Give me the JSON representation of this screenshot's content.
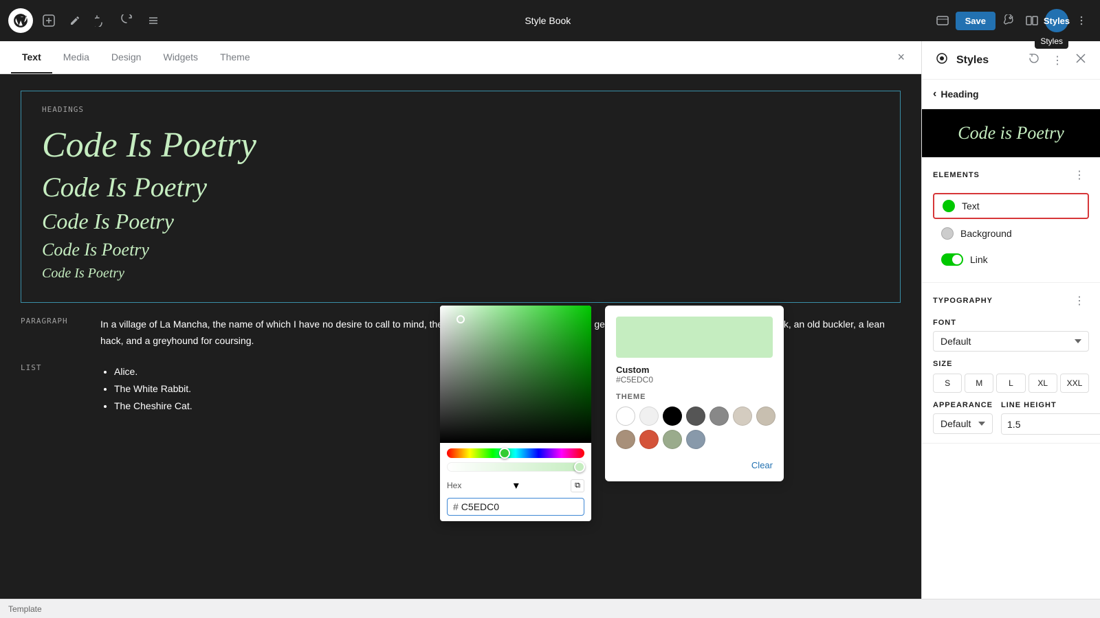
{
  "topbar": {
    "title": "Style Book",
    "save_label": "Save",
    "styles_label": "Styles",
    "styles_tooltip": "Styles"
  },
  "tabs": {
    "items": [
      {
        "label": "Text",
        "active": true
      },
      {
        "label": "Media",
        "active": false
      },
      {
        "label": "Design",
        "active": false
      },
      {
        "label": "Widgets",
        "active": false
      },
      {
        "label": "Theme",
        "active": false
      }
    ]
  },
  "canvas": {
    "headings_label": "HEADINGS",
    "heading_1": "Code Is Poetry",
    "heading_2": "Code Is Poetry",
    "heading_3": "Code Is Poetry",
    "heading_4": "Code Is Poetry",
    "heading_5": "Code Is Poetry",
    "paragraph_label": "PARAGRAPH",
    "paragraph_text": "In a village of La Mancha, the name of which I have no desire to call to mind, there lived not long since one of those gentlemen that keep a lance in the lance-rack, an old buckler, a lean hack, and a greyhound for coursing.",
    "list_label": "LIST",
    "list_item_1": "Alice.",
    "list_item_2": "The White Rabbit.",
    "list_item_3": "The Cheshire Cat."
  },
  "color_picker": {
    "format_label": "Hex",
    "hex_value": "C5EDC0",
    "hash_symbol": "#"
  },
  "theme_popup": {
    "custom_label": "Custom",
    "hex_label": "#C5EDC0",
    "section_label": "THEME",
    "clear_label": "Clear"
  },
  "right_panel": {
    "title": "Styles",
    "back_label": "Heading",
    "preview_text": "Code is Poetry",
    "elements_label": "ELEMENTS",
    "text_label": "Text",
    "background_label": "Background",
    "link_label": "Link",
    "typography_label": "Typography",
    "font_label": "FONT",
    "font_value": "Default",
    "size_label": "SIZE",
    "sizes": [
      "S",
      "M",
      "L",
      "XL",
      "XXL"
    ],
    "appearance_label": "APPEARANCE",
    "appearance_value": "Default",
    "line_height_label": "LINE HEIGHT",
    "line_height_value": "1.5"
  },
  "status_bar": {
    "label": "Template"
  }
}
